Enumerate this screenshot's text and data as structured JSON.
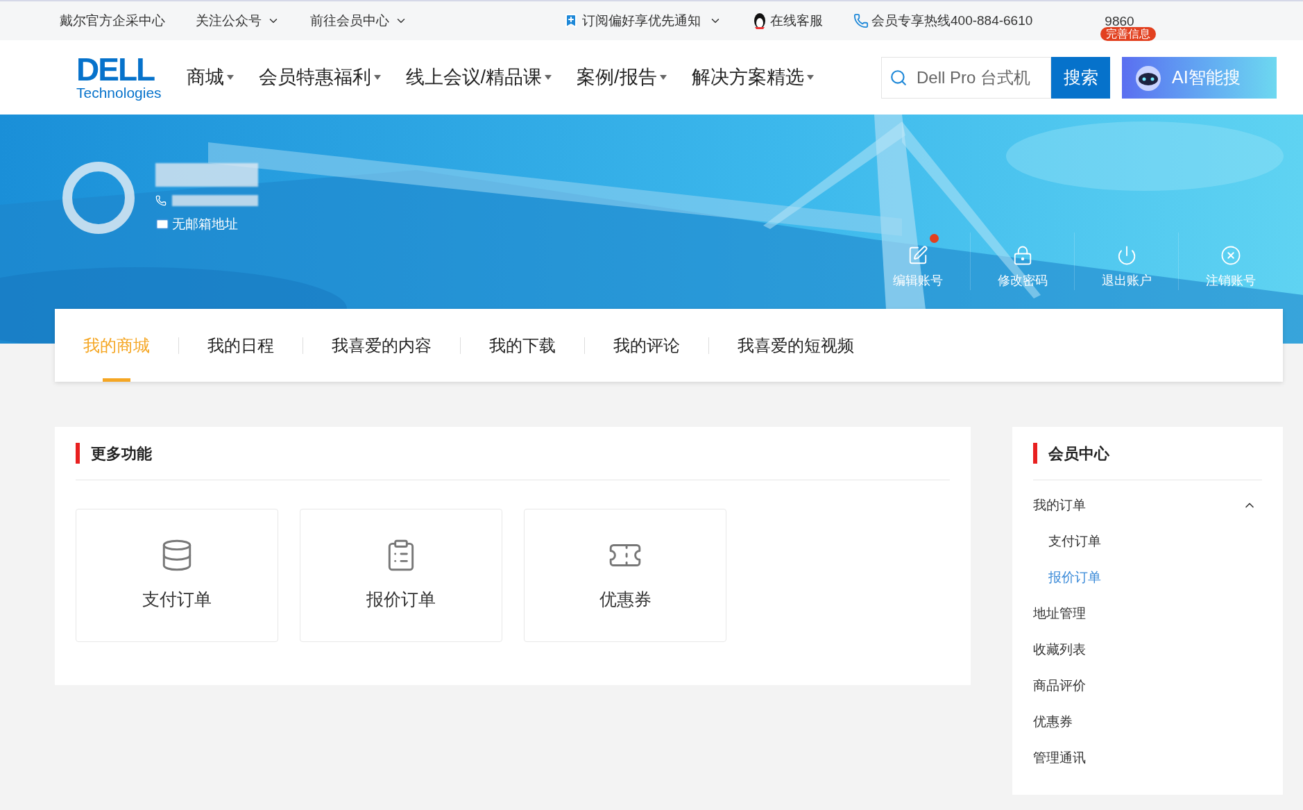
{
  "top_bar": {
    "links": [
      {
        "label": "戴尔官方企采中心",
        "dropdown": false
      },
      {
        "label": "关注公众号",
        "dropdown": true
      },
      {
        "label": "前往会员中心",
        "dropdown": true
      }
    ],
    "subscribe": {
      "label": "订阅偏好享优先通知",
      "dropdown": true
    },
    "service": {
      "label": "在线客服"
    },
    "hotline": {
      "label": "会员专享热线400-884-6610"
    },
    "points": {
      "value": "9860",
      "badge": "完善信息"
    }
  },
  "nav": {
    "logo": {
      "wordmark": "DELL",
      "tagline": "Technologies"
    },
    "menu": [
      {
        "label": "商城",
        "dropdown": true
      },
      {
        "label": "会员特惠福利",
        "dropdown": true
      },
      {
        "label": "线上会议/精品课",
        "dropdown": true
      },
      {
        "label": "案例/报告",
        "dropdown": true
      },
      {
        "label": "解决方案精选",
        "dropdown": true
      }
    ],
    "search": {
      "placeholder": "Dell Pro 台式机",
      "button": "搜索"
    },
    "ai_button": {
      "label": "AI智能搜"
    }
  },
  "profile": {
    "email": "无邮箱地址",
    "actions": [
      {
        "label": "编辑账号",
        "kind": "edit",
        "badge": true
      },
      {
        "label": "修改密码",
        "kind": "password",
        "badge": false
      },
      {
        "label": "退出账户",
        "kind": "power",
        "badge": false
      },
      {
        "label": "注销账号",
        "kind": "close",
        "badge": false
      }
    ]
  },
  "tabs": [
    {
      "label": "我的商城",
      "selected": true
    },
    {
      "label": "我的日程",
      "selected": false
    },
    {
      "label": "我喜爱的内容",
      "selected": false
    },
    {
      "label": "我的下载",
      "selected": false
    },
    {
      "label": "我的评论",
      "selected": false
    },
    {
      "label": "我喜爱的短视频",
      "selected": false
    }
  ],
  "more_features": {
    "title": "更多功能",
    "cards": [
      {
        "label": "支付订单",
        "kind": "coins"
      },
      {
        "label": "报价订单",
        "kind": "clipboard"
      },
      {
        "label": "优惠券",
        "kind": "coupon"
      }
    ]
  },
  "member_center": {
    "title": "会员中心",
    "items": [
      {
        "label": "我的订单",
        "selected": false,
        "expanded": true,
        "children": [
          {
            "label": "支付订单",
            "selected": false
          },
          {
            "label": "报价订单",
            "selected": true
          }
        ]
      },
      {
        "label": "地址管理",
        "selected": false
      },
      {
        "label": "收藏列表",
        "selected": false
      },
      {
        "label": "商品评价",
        "selected": false
      },
      {
        "label": "优惠券",
        "selected": false
      },
      {
        "label": "管理通讯",
        "selected": false
      }
    ]
  }
}
